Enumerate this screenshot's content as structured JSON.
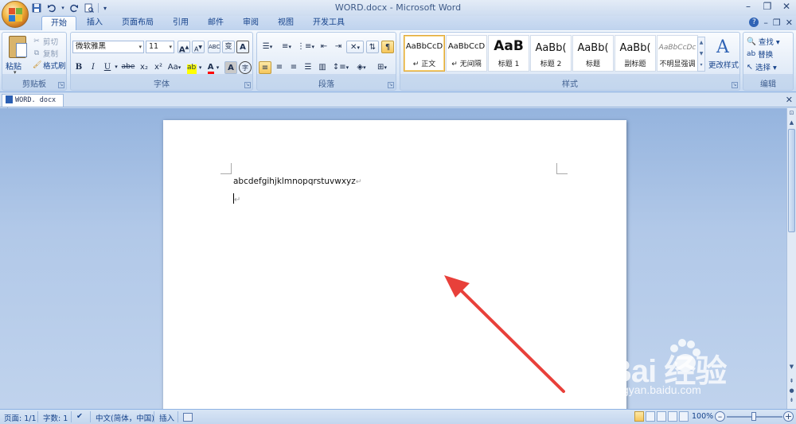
{
  "window": {
    "title": "WORD.docx - Microsoft Word"
  },
  "quick_access": {
    "save_icon": "save-icon",
    "undo_icon": "undo-icon",
    "redo_icon": "redo-icon",
    "print_preview_icon": "print-preview-icon",
    "customize": "▾"
  },
  "window_controls": {
    "minimize": "–",
    "restore": "❐",
    "close": "✕"
  },
  "ribbon_controls": {
    "help": "?",
    "minimize": "–",
    "restore": "❐",
    "close": "✕"
  },
  "tabs": [
    {
      "label": "开始",
      "active": true
    },
    {
      "label": "插入"
    },
    {
      "label": "页面布局"
    },
    {
      "label": "引用"
    },
    {
      "label": "邮件"
    },
    {
      "label": "审阅"
    },
    {
      "label": "视图"
    },
    {
      "label": "开发工具"
    }
  ],
  "clipboard": {
    "label": "剪贴板",
    "paste": "粘贴",
    "cut": "剪切",
    "copy": "复制",
    "format_painter": "格式刷"
  },
  "font": {
    "label": "字体",
    "font_name": "微软雅黑",
    "font_size": "11",
    "grow": "A",
    "shrink": "A",
    "bold": "B",
    "italic": "I",
    "underline": "U",
    "strike": "abe",
    "subscript": "x₂",
    "superscript": "x²",
    "change_case": "Aa",
    "font_color": "A",
    "char_shading": "A",
    "enclose": "字",
    "clear": "ABC",
    "phonetic": "变"
  },
  "paragraph": {
    "label": "段落"
  },
  "styles": {
    "label": "样式",
    "items": [
      {
        "sample": "AaBbCcD",
        "name": "↵ 正文",
        "selected": true
      },
      {
        "sample": "AaBbCcD",
        "name": "↵ 无间隔"
      },
      {
        "sample": "AaB",
        "name": "标题 1"
      },
      {
        "sample": "AaBb(",
        "name": "标题 2"
      },
      {
        "sample": "AaBb(",
        "name": "标题"
      },
      {
        "sample": "AaBb(",
        "name": "副标题"
      },
      {
        "sample": "AaBbCcDc",
        "name": "不明显强调"
      }
    ],
    "change_styles": "更改样式"
  },
  "editing": {
    "label": "编辑",
    "find": "查找 ▾",
    "replace": "替换",
    "select": "选择 ▾"
  },
  "doc_tab": {
    "label": "WORD. docx  *",
    "close": "✕"
  },
  "document": {
    "line1": "abcdefgihjklmnopqrstuvwxyz",
    "para_mark": "↵"
  },
  "watermark": {
    "brand": "Bai  经验",
    "url": "jingyan.baidu.com"
  },
  "status": {
    "page": "页面: 1/1",
    "words": "字数: 1",
    "language": "中文(简体，中国)",
    "mode": "插入",
    "zoom": "100%",
    "zoom_out": "–",
    "zoom_in": "+"
  },
  "colors": {
    "accent": "#15428b",
    "arrow": "#e8403a",
    "highlight": "#ffff00",
    "font_color_bar": "#ff0000"
  }
}
